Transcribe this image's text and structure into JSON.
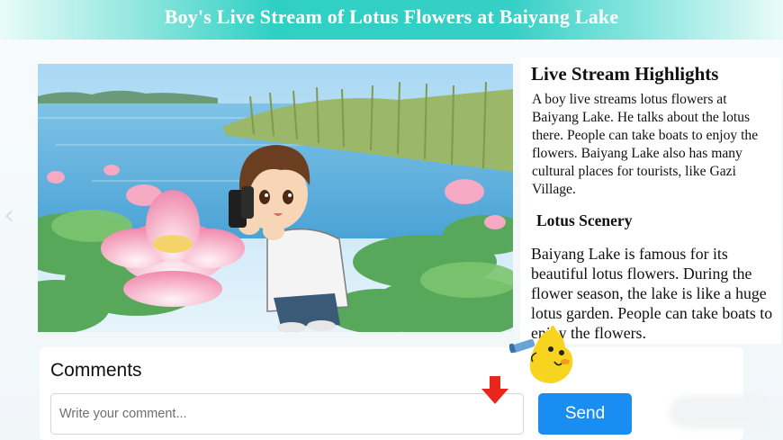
{
  "header": {
    "title": "Boy's Live Stream of Lotus Flowers at Baiyang Lake"
  },
  "stream": {
    "image_alt": "A boy filming lotus flowers with a phone at the lake"
  },
  "highlights": {
    "heading": "Live Stream Highlights",
    "text": "A boy live streams lotus flowers at Baiyang Lake. He talks about the lotus there. People can take boats to enjoy the flowers. Baiyang Lake also has many cultural places for tourists, like Gazi Village."
  },
  "scenery": {
    "heading": "Lotus Scenery",
    "text": "Baiyang Lake is famous for its beautiful lotus flowers. During the flower season, the lake is like a huge lotus garden. People can take boats to enjoy the flowers."
  },
  "comments": {
    "title": "Comments",
    "placeholder": "Write your comment...",
    "value": "",
    "send_label": "Send"
  },
  "colors": {
    "header_accent": "#35cfc5",
    "send_button": "#1a8df2",
    "arrow": "#e8261c",
    "mascot": "#f7d420"
  },
  "icons": [
    "chevron-left-icon",
    "chevron-right-icon",
    "down-arrow-icon",
    "mascot-icon"
  ]
}
